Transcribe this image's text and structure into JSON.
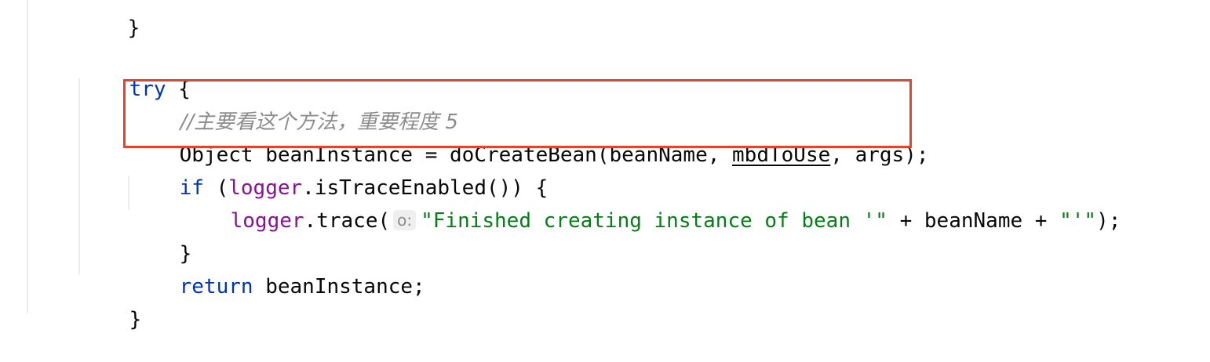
{
  "code": {
    "prev_brace": "}",
    "try_kw": "try",
    "try_brace": " {",
    "comment": "//主要看这个方法，重要程度 5",
    "object_type": "Object beanInstance = doCreateBean(beanName, ",
    "mbd_var": "mbdToUse",
    "object_tail": ", args);",
    "if_kw": "if",
    "if_open": " (",
    "logger1": "logger",
    "if_call": ".isTraceEnabled()) {",
    "logger2": "logger",
    "trace_call": ".trace(",
    "hint_label": "o:",
    "trace_str": "\"Finished creating instance of bean '\"",
    "trace_mid": " + beanName + ",
    "trace_str2": "\"'\"",
    "trace_end": ");",
    "if_close": "}",
    "return_kw": "return",
    "return_rest": " beanInstance;",
    "try_close": "}"
  },
  "colors": {
    "keyword": "#0033b3",
    "field": "#871094",
    "string": "#067d17",
    "comment": "#8c8c8c",
    "highlight_border": "#e1452e"
  }
}
